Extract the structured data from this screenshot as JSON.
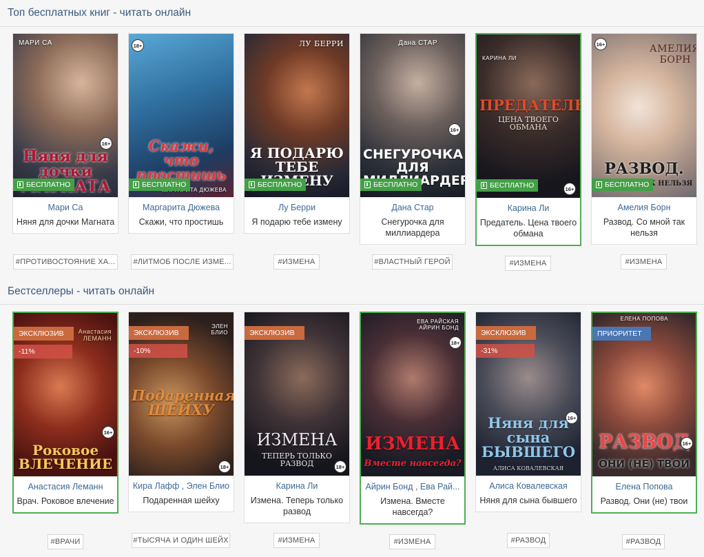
{
  "sections": [
    {
      "title": "Топ бесплатных книг - читать онлайн"
    },
    {
      "title": "Бестселлеры - читать онлайн"
    }
  ],
  "top_free": [
    {
      "author": "Мари Са",
      "title": "Няня для дочки Магната",
      "tag": "#ПРОТИВОСТОЯНИЕ ХА...",
      "badge": "БЕСПЛАТНО",
      "cover_title": "Няня для дочки МАГНАТА",
      "cover_author": "МАРИ СА",
      "age": "16+"
    },
    {
      "author": "Маргарита Дюжева",
      "title": "Скажи, что простишь",
      "tag": "#ЛИТМОБ ПОСЛЕ ИЗМЕ...",
      "badge": "БЕСПЛАТНО",
      "cover_title": "Скажи, что простишь",
      "cover_author": "МАРГАРИТА ДЮЖЕВА",
      "age": "18+"
    },
    {
      "author": "Лу Берри",
      "title": "Я подарю тебе измену",
      "tag": "#ИЗМЕНА",
      "badge": "БЕСПЛАТНО",
      "cover_title": "Я ПОДАРЮ ТЕБЕ ИЗМЕНУ",
      "cover_author": "ЛУ БЕРРИ",
      "age": ""
    },
    {
      "author": "Дана Стар",
      "title": "Снегурочка для миллиардера",
      "tag": "#ВЛАСТНЫЙ ГЕРОЙ",
      "badge": "БЕСПЛАТНО",
      "cover_title": "СНЕГУРОЧКА ДЛЯ МИЛЛИАРДЕРА",
      "cover_author": "Дана СТАР",
      "age": "16+"
    },
    {
      "author": "Карина Ли",
      "title": "Предатель. Цена твоего обмана",
      "tag": "#ИЗМЕНА",
      "badge": "БЕСПЛАТНО",
      "cover_title": "ПРЕДАТЕЛЬ",
      "cover_subtitle": "ЦЕНА ТВОЕГО ОБМАНА",
      "cover_author": "КАРИНА ЛИ",
      "age": "16+"
    },
    {
      "author": "Амелия Борн",
      "title": "Развод. Со мной так нельзя",
      "tag": "#ИЗМЕНА",
      "badge": "БЕСПЛАТНО",
      "cover_title": "РАЗВОД.",
      "cover_subtitle": "СО МНОЙ ТАК НЕЛЬЗЯ",
      "cover_author": "АМЕЛИЯ БОРН",
      "age": "16+"
    }
  ],
  "bestsellers": [
    {
      "author": "Анастасия Леманн",
      "title": "Врач. Роковое влечение",
      "tag": "#ВРАЧИ",
      "badge": "ЭКСКЛЮЗИВ",
      "discount": "-11%",
      "cover_title": "Роковое ВЛЕЧЕНИЕ",
      "cover_author": "Анастасия ЛЕМАНН",
      "age": "16+"
    },
    {
      "author": "Кира Лафф , Элен Блио",
      "title": "Подаренная шейху",
      "tag": "#ТЫСЯЧА И ОДИН ШЕЙХ",
      "badge": "ЭКСКЛЮЗИВ",
      "discount": "-10%",
      "cover_title": "Подаренная ШЕЙХУ",
      "cover_author": "ЭЛЕН БЛИО",
      "age": "18+"
    },
    {
      "author": "Карина Ли",
      "title": "Измена. Теперь только развод",
      "tag": "#ИЗМЕНА",
      "badge": "ЭКСКЛЮЗИВ",
      "discount": "",
      "cover_title": "ИЗМЕНА",
      "cover_subtitle": "ТЕПЕРЬ ТОЛЬКО РАЗВОД",
      "cover_author": "",
      "age": "18+"
    },
    {
      "author": "Айрин Бонд , Ева Рай...",
      "title": "Измена. Вместе навсегда?",
      "tag": "#ИЗМЕНА",
      "badge": "",
      "discount": "",
      "cover_title": "ИЗМЕНА",
      "cover_subtitle": "Вместе навсегда?",
      "cover_author": "ЕВА РАЙСКАЯ АЙРИН БОНД",
      "age": "18+"
    },
    {
      "author": "Алиса Ковалевская",
      "title": "Няня для сына бывшего",
      "tag": "#РАЗВОД",
      "badge": "ЭКСКЛЮЗИВ",
      "discount": "-31%",
      "cover_title": "Няня для сына БЫВШЕГО",
      "cover_subtitle": "АЛИСА КОВАЛЕВСКАЯ",
      "cover_author": "",
      "age": "16+"
    },
    {
      "author": "Елена Попова",
      "title": "Развод. Они (не) твои",
      "tag": "#РАЗВОД",
      "badge": "ПРИОРИТЕТ",
      "discount": "",
      "cover_title": "РАЗВОД",
      "cover_subtitle": "ОНИ (НЕ) ТВОИ",
      "cover_author": "ЕЛЕНА ПОПОВА",
      "age": "16+"
    }
  ],
  "colors": {
    "link": "#3d6a96",
    "section_title": "#3a5a7c",
    "free_badge": "#43a047",
    "exclusive_badge": "#c96a3e",
    "priority_badge": "#4a76b4",
    "discount_badge": "#d25046",
    "highlight_border": "#4caf50"
  }
}
